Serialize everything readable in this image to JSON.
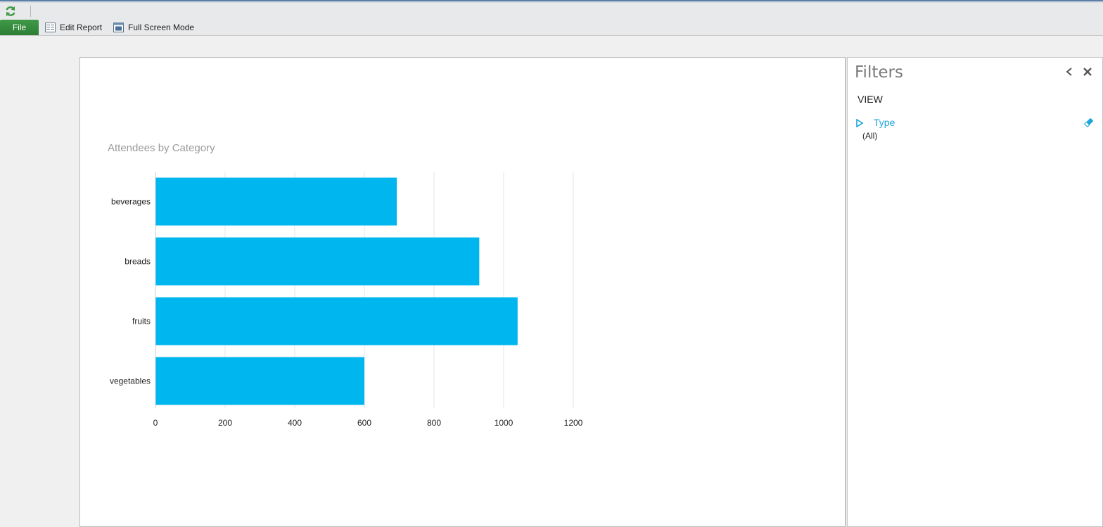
{
  "toolbar": {
    "refresh_icon": "refresh-icon",
    "file_label": "File",
    "edit_report_label": "Edit Report",
    "full_screen_label": "Full Screen Mode"
  },
  "filters": {
    "title": "Filters",
    "section": "VIEW",
    "field": "Type",
    "value": "(All)",
    "accent": "#1aa5dc"
  },
  "chart_data": {
    "type": "bar",
    "orientation": "horizontal",
    "title": "Attendees by Category",
    "categories": [
      "beverages",
      "breads",
      "fruits",
      "vegetables"
    ],
    "values": [
      693,
      930,
      1040,
      600
    ],
    "xlim": [
      0,
      1200
    ],
    "x_ticks": [
      0,
      200,
      400,
      600,
      800,
      1000,
      1200
    ],
    "grid": true,
    "bar_color": "#00b6ef"
  }
}
